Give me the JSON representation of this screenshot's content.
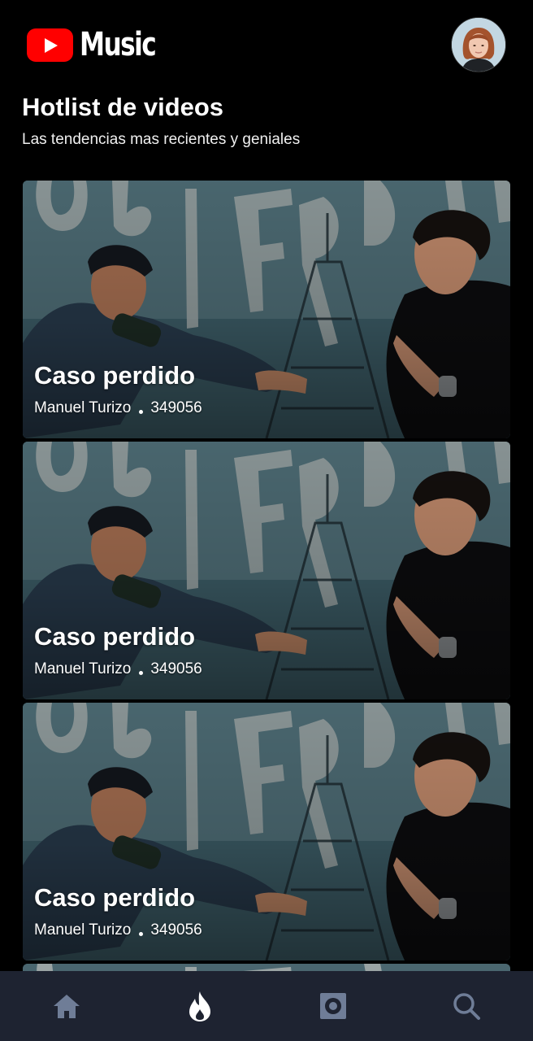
{
  "app": {
    "logo_text": "Music",
    "brand_color": "#ff0000"
  },
  "page": {
    "title": "Hotlist de videos",
    "subtitle": "Las tendencias mas recientes y geniales"
  },
  "videos": [
    {
      "title": "Caso perdido",
      "artist": "Manuel Turizo",
      "views": "349056"
    },
    {
      "title": "Caso perdido",
      "artist": "Manuel Turizo",
      "views": "349056"
    },
    {
      "title": "Caso perdido",
      "artist": "Manuel Turizo",
      "views": "349056"
    }
  ],
  "bottom_nav": {
    "items": [
      {
        "icon": "home-icon",
        "active": false
      },
      {
        "icon": "flame-icon",
        "active": true
      },
      {
        "icon": "library-icon",
        "active": false
      },
      {
        "icon": "search-icon",
        "active": false
      }
    ],
    "active_color": "#ffffff",
    "inactive_color": "#6f7d97",
    "background": "#1e2331"
  }
}
